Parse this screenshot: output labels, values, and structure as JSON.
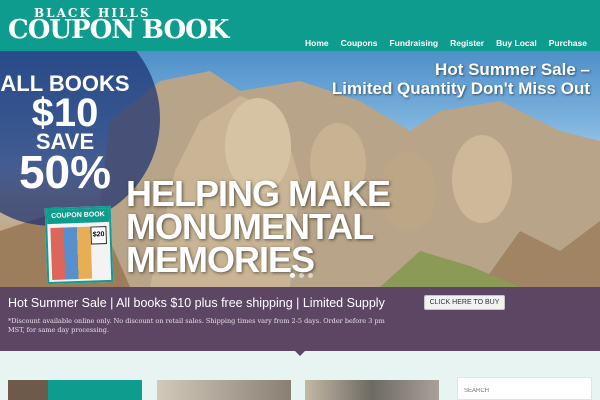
{
  "header": {
    "logo_top": "BLACK HILLS",
    "logo_main": "COUPON BOOK",
    "nav": [
      "Home",
      "Coupons",
      "Fundraising",
      "Register",
      "Buy Local",
      "Purchase"
    ]
  },
  "hero": {
    "badge": {
      "line1": "ALL BOOKS",
      "line2": "$10",
      "line3": "SAVE",
      "line4": "50%"
    },
    "headline_line1": "Hot Summer Sale –",
    "headline_line2": "Limited Quantity Don't Miss Out",
    "tagline_line1": "HELPING MAKE",
    "tagline_line2": "MONUMENTAL",
    "tagline_line3": "MEMORIES",
    "book": {
      "title": "COUPON BOOK",
      "price": "$20"
    },
    "slides": 3,
    "active_slide": 1
  },
  "promo": {
    "title": "Hot Summer Sale | All books $10 plus free shipping | Limited Supply",
    "note": "*Discount available online only. No discount on retail sales. Shipping times vary from 2-5 days. Order before 3 pm MST, for same day processing.",
    "button": "CLICK HERE TO BUY"
  },
  "search": {
    "placeholder": "SEARCH"
  },
  "colors": {
    "header": "#0e9c8e",
    "promo": "#5d4664",
    "background": "#e7f4f1",
    "badge": "#1c3070"
  }
}
